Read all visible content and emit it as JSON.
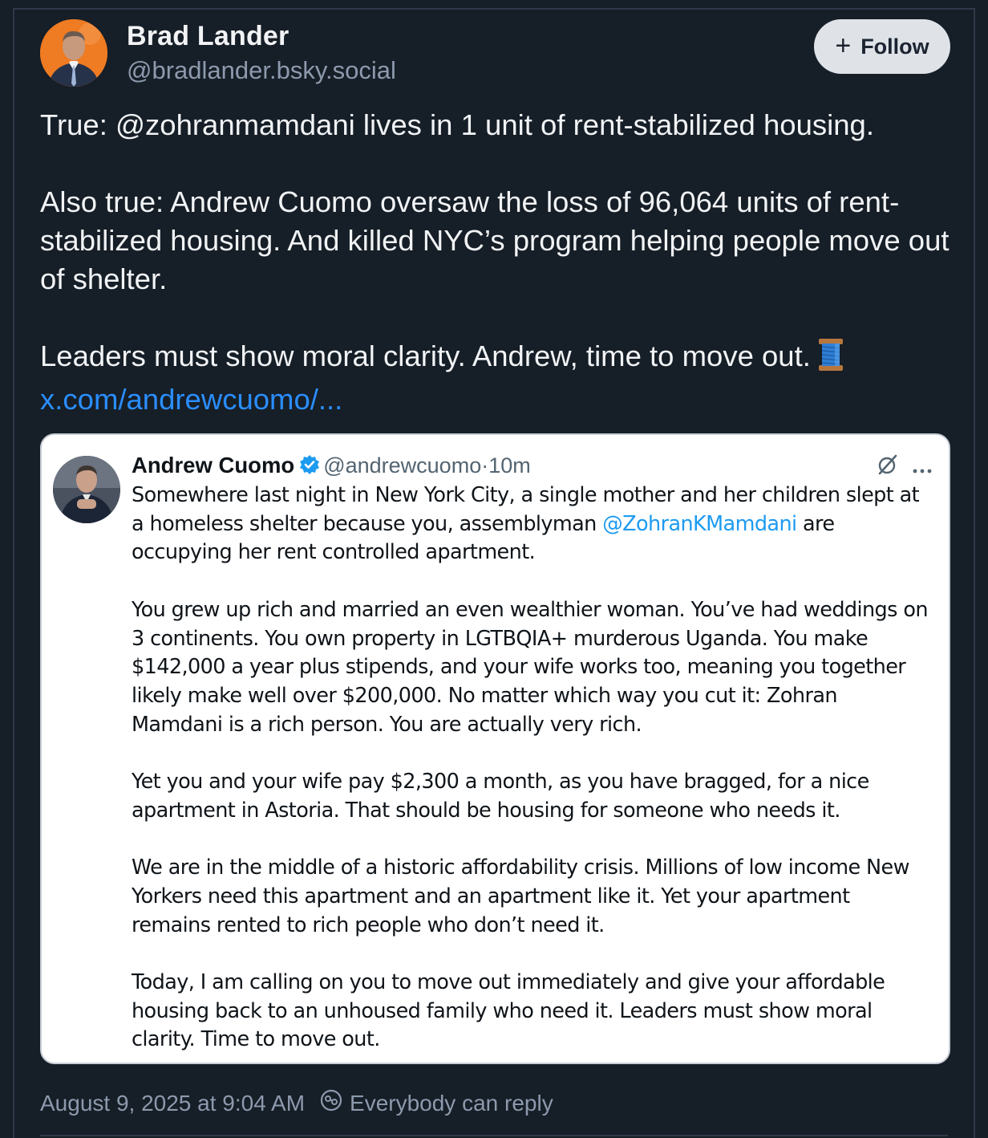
{
  "author": {
    "name": "Brad Lander",
    "handle": "@bradlander.bsky.social"
  },
  "follow_button": {
    "icon": "plus-icon",
    "label": "Follow"
  },
  "post": {
    "paragraphs": [
      "True: @zohranmamdani lives in 1 unit of rent-stabilized housing.",
      "Also true: Andrew Cuomo oversaw the loss of 96,064 units of rent-stabilized housing. And killed NYC’s program helping people move out of shelter.",
      "Leaders must show moral clarity. Andrew, time to move out."
    ],
    "emoji": "spool-of-thread-icon",
    "link_text": "x.com/andrewcuomo/..."
  },
  "embedded_tweet": {
    "name": "Andrew Cuomo",
    "handle": "@andrewcuomo",
    "separator": "·",
    "time": "10m",
    "icons": [
      "grok-icon",
      "more-options-icon"
    ],
    "p1_before": "Somewhere last night in New York City, a single mother and her children slept at a homeless shelter because you, assemblyman ",
    "p1_mention": "@ZohranKMamdani",
    "p1_after": "  are occupying her rent controlled apartment.",
    "p2": "You grew up rich and married an even wealthier woman. You’ve had weddings on 3 continents. You own property in LGTBQIA+ murderous Uganda. You make $142,000 a year plus stipends, and your wife works too, meaning you together likely make well over $200,000. No matter which way you cut it: Zohran Mamdani is a rich person. You are actually very rich.",
    "p3": "Yet you and your wife pay $2,300 a month, as you have bragged, for a nice apartment in Astoria. That should be housing for someone who needs it.",
    "p4": "We are in the middle of a historic affordability crisis. Millions of low income New Yorkers need this apartment and an apartment like it. Yet your apartment remains rented to rich people who don’t need it.",
    "p5": "Today, I am calling on you to move out immediately and give your affordable housing back to an unhoused family who need it. Leaders must show moral clarity. Time to move out."
  },
  "footer": {
    "timestamp": "August 9, 2025 at 9:04 AM",
    "reply_icon": "reply-settings-icon",
    "reply_setting": "Everybody can reply"
  },
  "colors": {
    "background": "#161e27",
    "link": "#2a8eff",
    "muted": "#8d9aad",
    "mention": "#1d9bf0",
    "verified": "#1d9bf0"
  }
}
